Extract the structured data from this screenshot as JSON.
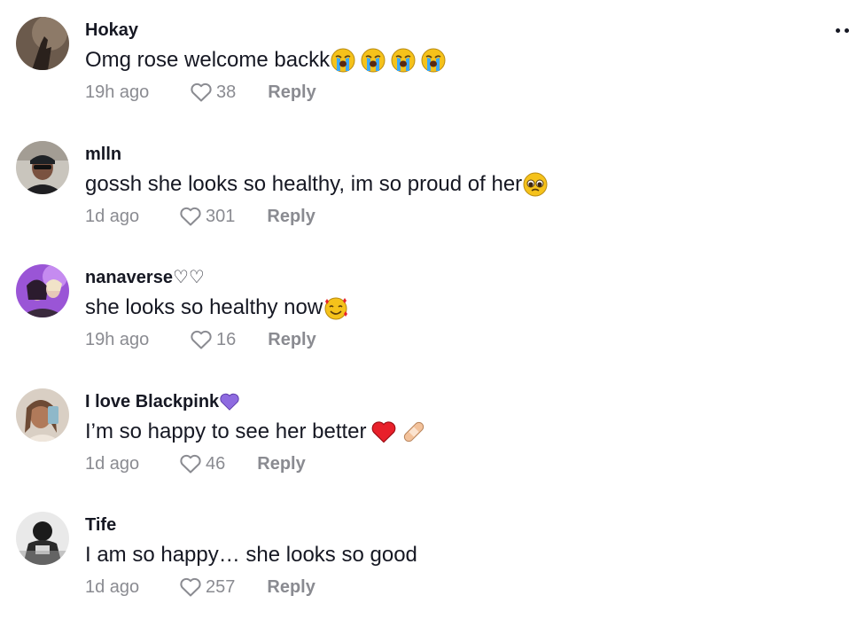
{
  "comments": [
    {
      "username": "Hokay",
      "text": "Omg rose welcome backk ",
      "time": "19h ago",
      "likes": "38",
      "reply": "Reply",
      "emojis": [
        "loudly-crying-face",
        "loudly-crying-face",
        "loudly-crying-face",
        "loudly-crying-face"
      ]
    },
    {
      "username": "mlln",
      "text": "gossh she looks so healthy, im so proud of her",
      "time": "1d ago",
      "likes": "301",
      "reply": "Reply",
      "emojis": [
        "pleading-face"
      ]
    },
    {
      "username": "nanaverse♡♡",
      "text": "she looks so healthy now",
      "time": "19h ago",
      "likes": "16",
      "reply": "Reply",
      "emojis": [
        "smiling-face-with-hearts"
      ]
    },
    {
      "username": "I love Blackpink",
      "text": "I’m so happy to see her better ",
      "time": "1d ago",
      "likes": "46",
      "reply": "Reply",
      "emojis": [
        "red-heart",
        "adhesive-bandage"
      ],
      "username_emoji": "purple-heart"
    },
    {
      "username": "Tife",
      "text": "I am so happy… she looks so good",
      "time": "1d ago",
      "likes": "257",
      "reply": "Reply",
      "emojis": []
    }
  ],
  "colors": {
    "text": "#161823",
    "muted": "#8a8b91",
    "emoji_yellow": "#f5c21b",
    "tear_blue": "#3da9f5",
    "red_heart": "#e8202a",
    "purple_heart": "#8e6be0"
  }
}
